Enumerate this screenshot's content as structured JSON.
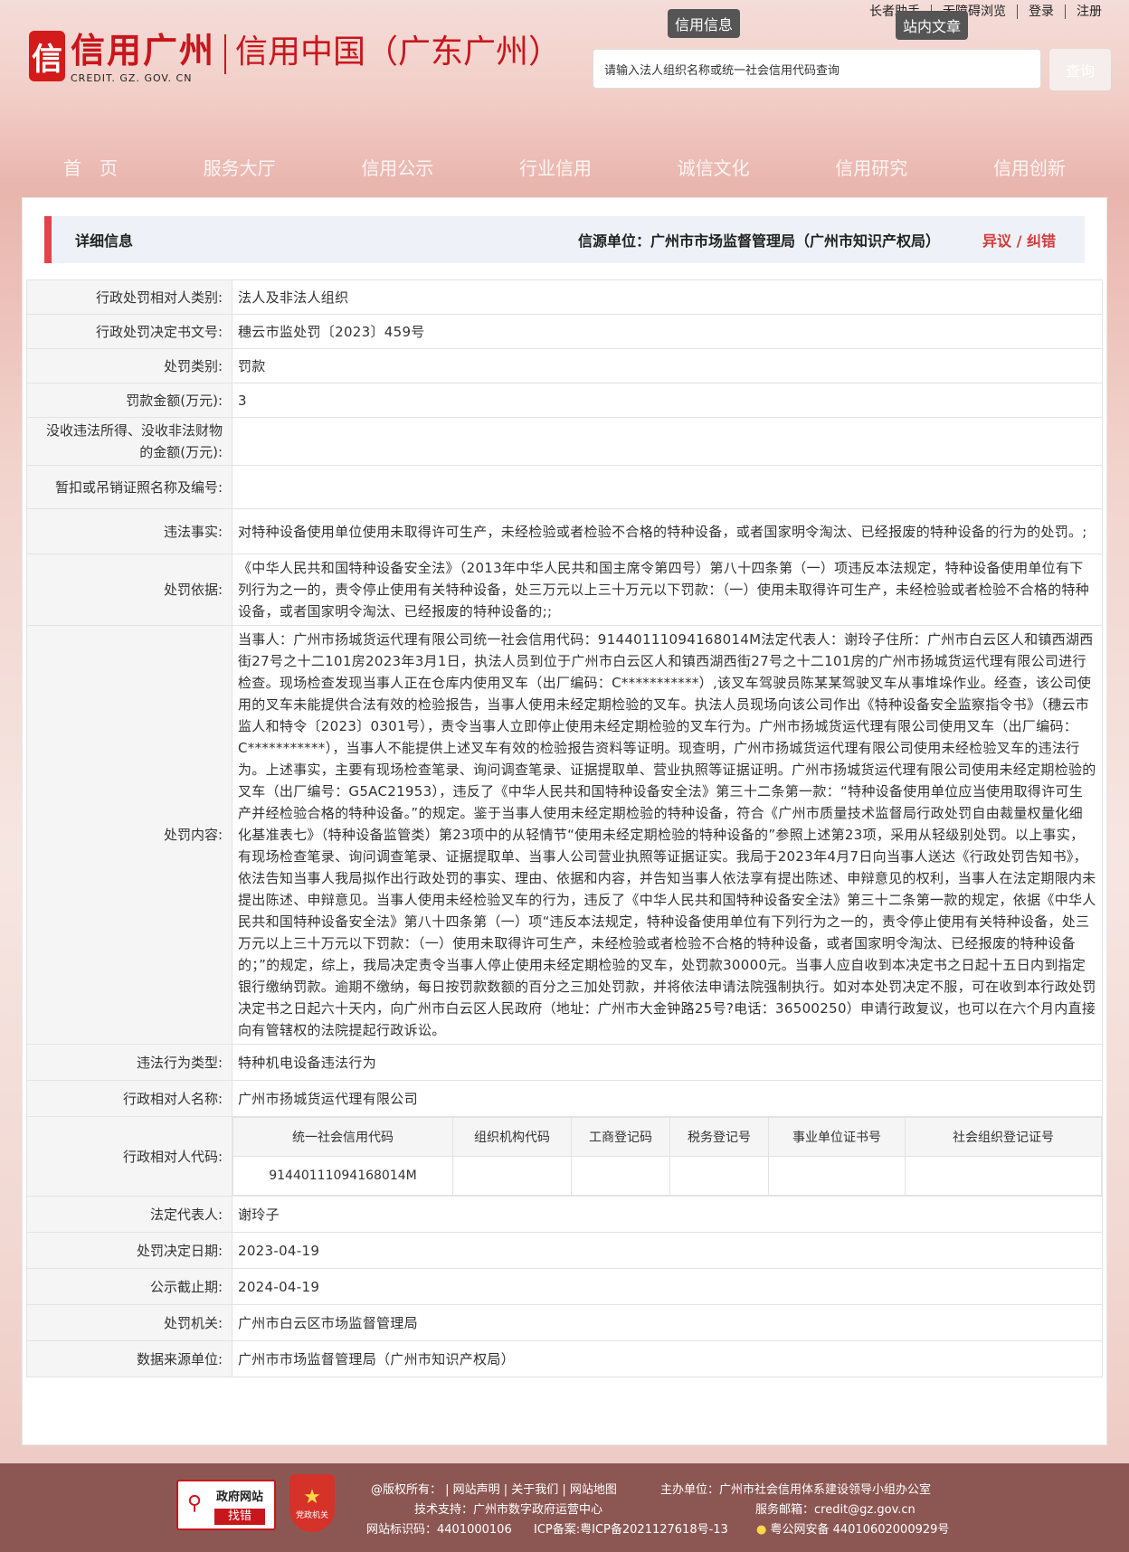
{
  "top_links": [
    "长者助手",
    "无障碍浏览",
    "登录",
    "注册"
  ],
  "tooltips": {
    "credit_info": "信用信息",
    "site_article": "站内文章"
  },
  "logo": {
    "mark": "信",
    "name": "信用广州",
    "domain": "CREDIT. GZ. GOV. CN",
    "title": "信用中国（广东广州）"
  },
  "search": {
    "placeholder": "请输入法人组织名称或统一社会信用代码查询",
    "button": "查询"
  },
  "nav": [
    "首　页",
    "服务大厅",
    "信用公示",
    "行业信用",
    "诚信文化",
    "信用研究",
    "信用创新"
  ],
  "detail": {
    "title": "详细信息",
    "source": "信源单位：广州市市场监督管理局（广州市知识产权局）",
    "objection": "异议 / 纠错"
  },
  "rows": {
    "r1_k": "行政处罚相对人类别:",
    "r1_v": "法人及非法人组织",
    "r2_k": "行政处罚决定书文号:",
    "r2_v": "穗云市监处罚〔2023〕459号",
    "r3_k": "处罚类别:",
    "r3_v": "罚款",
    "r4_k": "罚款金额(万元):",
    "r4_v": "3",
    "r5_k": "没收违法所得、没收非法财物的金额(万元):",
    "r5_v": "",
    "r6_k": "暂扣或吊销证照名称及编号:",
    "r6_v": "",
    "r7_k": "违法事实:",
    "r7_v": "对特种设备使用单位使用未取得许可生产，未经检验或者检验不合格的特种设备，或者国家明令淘汰、已经报废的特种设备的行为的处罚。;",
    "r8_k": "处罚依据:",
    "r8_v": "《中华人民共和国特种设备安全法》（2013年中华人民共和国主席令第四号）第八十四条第（一）项违反本法规定，特种设备使用单位有下列行为之一的，责令停止使用有关特种设备，处三万元以上三十万元以下罚款：（一）使用未取得许可生产，未经检验或者检验不合格的特种设备，或者国家明令淘汰、已经报废的特种设备的;;",
    "r9_k": "处罚内容:",
    "r9_v": "当事人：广州市扬城货运代理有限公司统一社会信用代码：91440111094168014M法定代表人：谢玲子住所：广州市白云区人和镇西湖西街27号之十二101房2023年3月1日，执法人员到位于广州市白云区人和镇西湖西街27号之十二101房的广州市扬城货运代理有限公司进行检查。现场检查发现当事人正在仓库内使用叉车（出厂编码：C***********）,该叉车驾驶员陈某某驾驶叉车从事堆垛作业。经查，该公司使用的叉车未能提供合法有效的检验报告，当事人使用未经定期检验的叉车。执法人员现场向该公司作出《特种设备安全监察指令书》（穗云市监人和特令〔2023〕0301号），责令当事人立即停止使用未经定期检验的叉车行为。广州市扬城货运代理有限公司使用叉车（出厂编码：C***********），当事人不能提供上述叉车有效的检验报告资料等证明。现查明，广州市扬城货运代理有限公司使用未经检验叉车的违法行为。上述事实，主要有现场检查笔录、询问调查笔录、证据提取单、营业执照等证据证明。广州市扬城货运代理有限公司使用未经定期检验的叉车（出厂编号：G5AC21953），违反了《中华人民共和国特种设备安全法》第三十二条第一款：“特种设备使用单位应当使用取得许可生产并经检验合格的特种设备。”的规定。鉴于当事人使用未经定期检验的特种设备，符合《广州市质量技术监督局行政处罚自由裁量权量化细化基准表七》（特种设备监管类）第23项中的从轻情节“使用未经定期检验的特种设备的”参照上述第23项，采用从轻级别处罚。以上事实，有现场检查笔录、询问调查笔录、证据提取单、当事人公司营业执照等证据证实。我局于2023年4月7日向当事人送达《行政处罚告知书》，依法告知当事人我局拟作出行政处罚的事实、理由、依据和内容，并告知当事人依法享有提出陈述、申辩意见的权利，当事人在法定期限内未提出陈述、申辩意见。当事人使用未经检验叉车的行为，违反了《中华人民共和国特种设备安全法》第三十二条第一款的规定，依据《中华人民共和国特种设备安全法》第八十四条第（一）项“违反本法规定，特种设备使用单位有下列行为之一的，责令停止使用有关特种设备，处三万元以上三十万元以下罚款：（一）使用未取得许可生产，未经检验或者检验不合格的特种设备，或者国家明令淘汰、已经报废的特种设备的；”的规定，综上，我局决定责令当事人停止使用未经定期检验的叉车，处罚款30000元。当事人应自收到本决定书之日起十五日内到指定银行缴纳罚款。逾期不缴纳，每日按罚款数额的百分之三加处罚款，并将依法申请法院强制执行。如对本处罚决定不服，可在收到本行政处罚决定书之日起六十天内，向广州市白云区人民政府（地址：广州市大金钟路25号?电话：36500250）申请行政复议，也可以在六个月内直接向有管辖权的法院提起行政诉讼。",
    "r10_k": "违法行为类型:",
    "r10_v": "特种机电设备违法行为",
    "r11_k": "行政相对人名称:",
    "r11_v": "广州市扬城货运代理有限公司",
    "r12_k": "行政相对人代码:",
    "r13_k": "法定代表人:",
    "r13_v": "谢玲子",
    "r14_k": "处罚决定日期:",
    "r14_v": "2023-04-19",
    "r15_k": "公示截止期:",
    "r15_v": "2024-04-19",
    "r16_k": "处罚机关:",
    "r16_v": "广州市白云区市场监督管理局",
    "r17_k": "数据来源单位:",
    "r17_v": "广州市市场监督管理局（广州市知识产权局）"
  },
  "codes": {
    "h1": "统一社会信用代码",
    "h2": "组织机构代码",
    "h3": "工商登记码",
    "h4": "税务登记号",
    "h5": "事业单位证书号",
    "h6": "社会组织登记证号",
    "v1": "91440111094168014M",
    "v2": "",
    "v3": "",
    "v4": "",
    "v5": "",
    "v6": ""
  },
  "footer": {
    "badge_title": "政府网站",
    "badge_sub": "找错",
    "party_label": "党政机关",
    "l1a": "@版权所有： | 网站声明 | 关于我们 | 网站地图",
    "l1b": "主办单位：广州市社会信用体系建设领导小组办公室",
    "l2a": "技术支持：广州市数字政府运营中心",
    "l2b": "服务邮箱：credit@gz.gov.cn",
    "l3a": "网站标识码：4401000106",
    "l3b": "ICP备案:粤ICP备2021127618号-13",
    "l3c": "粤公网安备 44010602000929号"
  }
}
